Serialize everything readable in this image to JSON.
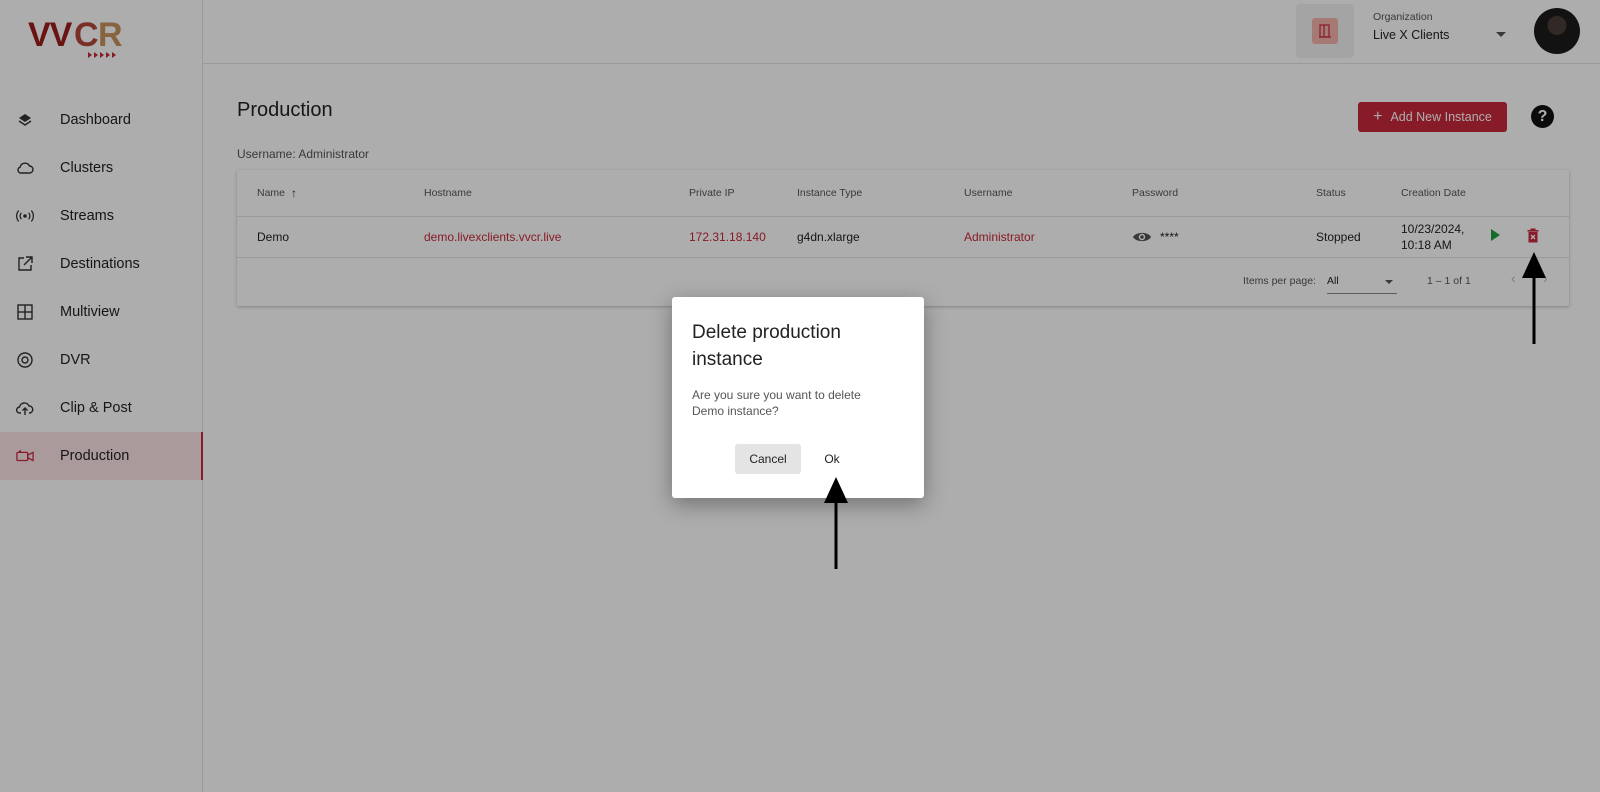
{
  "app": {
    "logo_text": "VVCR",
    "brand_color": "#c8283a"
  },
  "sidebar": {
    "items": [
      {
        "label": "Dashboard",
        "icon": "layers-icon"
      },
      {
        "label": "Clusters",
        "icon": "cloud-icon"
      },
      {
        "label": "Streams",
        "icon": "broadcast-icon"
      },
      {
        "label": "Destinations",
        "icon": "external-link-icon"
      },
      {
        "label": "Multiview",
        "icon": "grid-icon"
      },
      {
        "label": "DVR",
        "icon": "record-icon"
      },
      {
        "label": "Clip & Post",
        "icon": "cloud-upload-icon"
      },
      {
        "label": "Production",
        "icon": "video-camera-icon",
        "active": true
      }
    ]
  },
  "header": {
    "org_label": "Organization",
    "org_value": "Live X Clients"
  },
  "main": {
    "title": "Production",
    "add_button": "Add New Instance",
    "help": "?",
    "username_line": "Username: Administrator",
    "table": {
      "headers": [
        "Name",
        "Hostname",
        "Private IP",
        "Instance Type",
        "Username",
        "Password",
        "Status",
        "Creation Date"
      ],
      "rows": [
        {
          "name": "Demo",
          "hostname": "demo.livexclients.vvcr.live",
          "private_ip": "172.31.18.140",
          "instance_type": "g4dn.xlarge",
          "username": "Administrator",
          "password": "****",
          "status": "Stopped",
          "date_line1": "10/23/2024,",
          "date_line2": "10:18 AM"
        }
      ],
      "footer": {
        "items_per_page_label": "Items per page:",
        "items_per_page_value": "All",
        "range": "1 – 1 of 1"
      }
    }
  },
  "dialog": {
    "title": "Delete production instance",
    "body": "Are you sure you want to delete Demo instance?",
    "cancel": "Cancel",
    "ok": "Ok"
  }
}
